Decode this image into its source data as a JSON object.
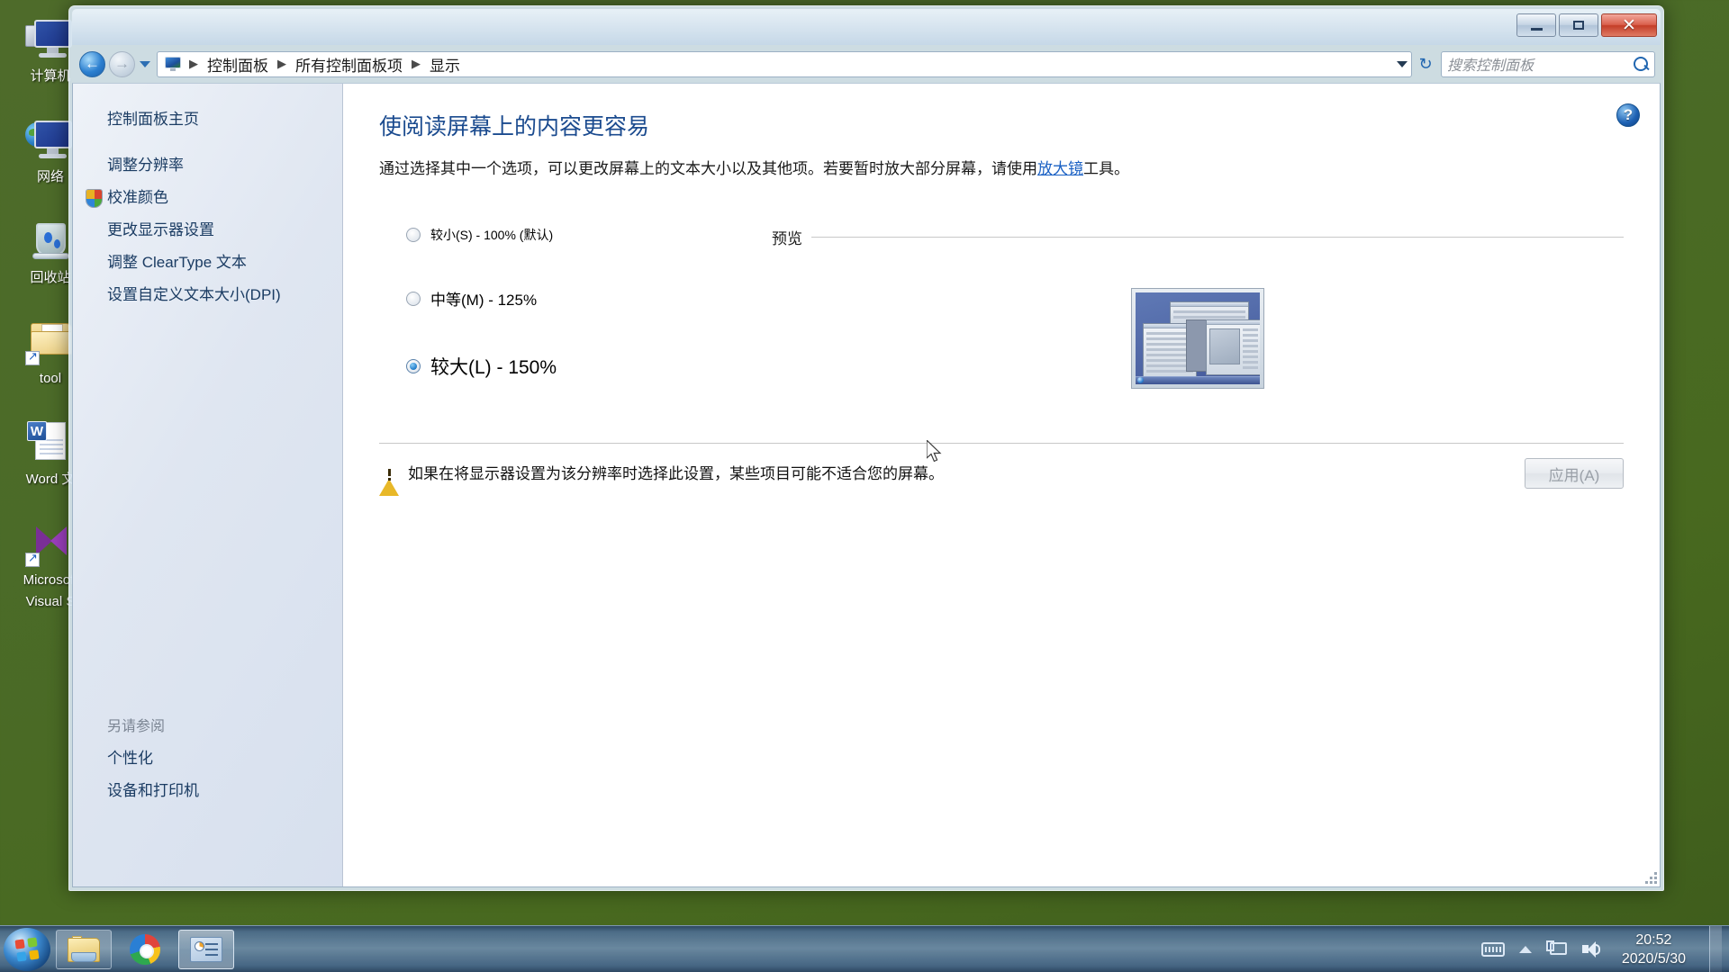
{
  "desktop": {
    "icons": [
      {
        "label": "计算机",
        "icon": "computer-icon"
      },
      {
        "label": "网络",
        "icon": "network-icon"
      },
      {
        "label": "回收站",
        "icon": "recycle-bin-icon"
      },
      {
        "label": "tool",
        "icon": "folder-shortcut-icon"
      },
      {
        "label": "Word 文",
        "icon": "word-document-icon"
      },
      {
        "label": "Microsoft",
        "label2": "Visual S",
        "icon": "visual-studio-icon"
      }
    ]
  },
  "window": {
    "title_bar": {
      "minimize_tooltip": "最小化",
      "maximize_tooltip": "最大化",
      "close_tooltip": "关闭",
      "close_glyph": "✕"
    },
    "nav": {
      "back_tooltip": "后退",
      "forward_tooltip": "前进",
      "refresh_glyph": "↻",
      "breadcrumb": [
        "控制面板",
        "所有控制面板项",
        "显示"
      ],
      "separator": "▶"
    },
    "search": {
      "placeholder": "搜索控制面板",
      "value": ""
    }
  },
  "sidebar": {
    "home_label": "控制面板主页",
    "items": [
      {
        "label": "调整分辨率",
        "shield": false
      },
      {
        "label": "校准颜色",
        "shield": true
      },
      {
        "label": "更改显示器设置",
        "shield": false
      },
      {
        "label": "调整 ClearType 文本",
        "shield": false
      },
      {
        "label": "设置自定义文本大小(DPI)",
        "shield": false
      }
    ],
    "see_also": {
      "title": "另请参阅",
      "items": [
        {
          "label": "个性化"
        },
        {
          "label": "设备和打印机"
        }
      ]
    }
  },
  "content": {
    "help_glyph": "?",
    "title": "使阅读屏幕上的内容更容易",
    "description_before": "通过选择其中一个选项，可以更改屏幕上的文本大小以及其他项。若要暂时放大部分屏幕，请使用",
    "description_link": "放大镜",
    "description_after": "工具。",
    "scale_options": [
      {
        "label": "较小(S) - 100% (默认)",
        "value": "100",
        "selected": false
      },
      {
        "label": "中等(M) - 125%",
        "value": "125",
        "selected": false
      },
      {
        "label": "较大(L) - 150%",
        "value": "150",
        "selected": true
      }
    ],
    "preview_label": "预览",
    "notice_text": "如果在将显示器设置为该分辨率时选择此设置，某些项目可能不适合您的屏幕。",
    "apply_label": "应用(A)",
    "apply_enabled": false
  },
  "taskbar": {
    "start_tooltip": "开始",
    "items": [
      {
        "name": "windows-explorer",
        "state": "pinned"
      },
      {
        "name": "chrome-browser",
        "state": "pinned"
      },
      {
        "name": "control-panel",
        "state": "active"
      }
    ],
    "tray": [
      {
        "name": "ime-keyboard-icon"
      },
      {
        "name": "show-hidden-icons-icon"
      },
      {
        "name": "network-icon"
      },
      {
        "name": "volume-icon"
      }
    ],
    "clock": {
      "time": "20:52",
      "date": "2020/5/30"
    }
  },
  "colors": {
    "accent": "#1b4b8f",
    "link": "#1b61c4",
    "desktop_bg": "#4b6b28",
    "warning": "#e8b828"
  }
}
